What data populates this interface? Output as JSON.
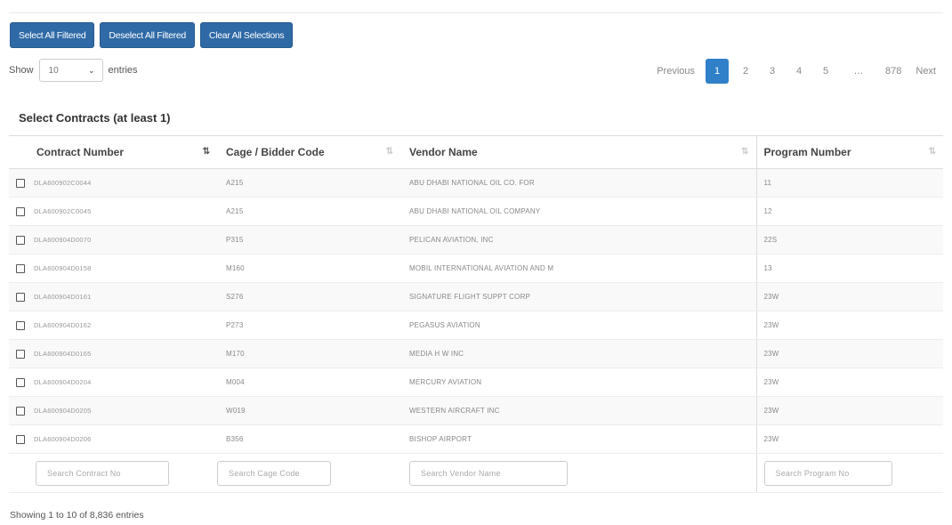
{
  "buttons": {
    "select_all": "Select All Filtered",
    "deselect_all": "Deselect All Filtered",
    "clear_all": "Clear All Selections"
  },
  "length": {
    "show": "Show",
    "value": "10",
    "entries": "entries"
  },
  "pagination": {
    "previous": "Previous",
    "pages": [
      "1",
      "2",
      "3",
      "4",
      "5"
    ],
    "ellipsis": "…",
    "last_page": "878",
    "next": "Next"
  },
  "section_title": "Select Contracts (at least 1)",
  "table": {
    "columns": [
      "Contract Number",
      "Cage / Bidder Code",
      "Vendor Name",
      "Program Number"
    ],
    "rows": [
      {
        "contract": "DLA600902C0044",
        "cage": "A215",
        "vendor": "ABU DHABI NATIONAL OIL CO. FOR",
        "program": "11"
      },
      {
        "contract": "DLA600902C0045",
        "cage": "A215",
        "vendor": "ABU DHABI NATIONAL OIL COMPANY",
        "program": "12"
      },
      {
        "contract": "DLA600904D0070",
        "cage": "P315",
        "vendor": "PELICAN AVIATION, INC",
        "program": "22S"
      },
      {
        "contract": "DLA600904D0158",
        "cage": "M160",
        "vendor": "MOBIL INTERNATIONAL AVIATION AND M",
        "program": "13"
      },
      {
        "contract": "DLA600904D0161",
        "cage": "S276",
        "vendor": "SIGNATURE FLIGHT SUPPT CORP",
        "program": "23W"
      },
      {
        "contract": "DLA600904D0162",
        "cage": "P273",
        "vendor": "PEGASUS AVIATION",
        "program": "23W"
      },
      {
        "contract": "DLA600904D0165",
        "cage": "M170",
        "vendor": "MEDIA H W INC",
        "program": "23W"
      },
      {
        "contract": "DLA600904D0204",
        "cage": "M004",
        "vendor": "MERCURY AVIATION",
        "program": "23W"
      },
      {
        "contract": "DLA600904D0205",
        "cage": "W019",
        "vendor": "WESTERN AIRCRAFT INC",
        "program": "23W"
      },
      {
        "contract": "DLA600904D0206",
        "cage": "B356",
        "vendor": "BISHOP AIRPORT",
        "program": "23W"
      }
    ],
    "search_placeholders": [
      "Search Contract No",
      "Search Cage Code",
      "Search Vendor Name",
      "Search Program No"
    ]
  },
  "info": "Showing 1 to 10 of 8,836 entries",
  "colors": {
    "button_bg": "#2f6aa6",
    "active_page": "#2f80c8"
  }
}
